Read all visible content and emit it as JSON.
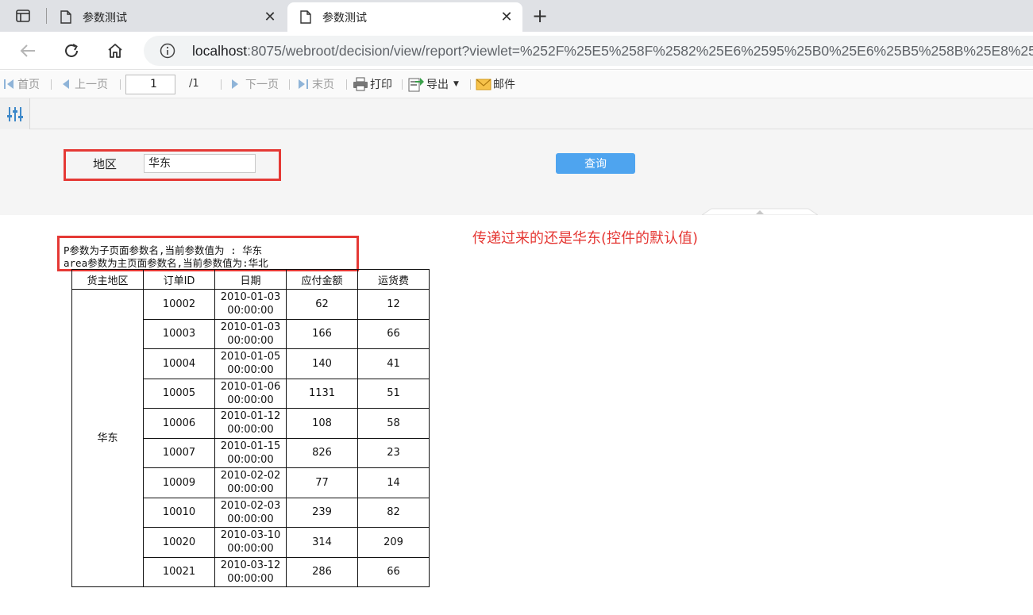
{
  "browser": {
    "tabs": [
      {
        "title": "参数测试",
        "active": false
      },
      {
        "title": "参数测试",
        "active": true
      }
    ],
    "close_glyph": "✕",
    "newtab_glyph": "+",
    "url_host": "localhost",
    "url_rest": ":8075/webroot/decision/view/report?viewlet=%252F%25E5%258F%2582%25E6%2595%25B0%25E6%25B5%258B%25E8%25AF%25"
  },
  "toolbar": {
    "first": "首页",
    "prev": "上一页",
    "page_value": "1",
    "page_total": "/1",
    "next": "下一页",
    "last": "末页",
    "print": "打印",
    "export": "导出",
    "mail": "邮件"
  },
  "params": {
    "area_label": "地区",
    "area_value": "华东",
    "query_label": "查询"
  },
  "annotation": "传递过来的还是华东(控件的默认值)",
  "param_info": {
    "line1": "P参数为子页面参数名,当前参数值为 : 华东",
    "line2": "area参数为主页面参数名,当前参数值为:华北"
  },
  "table": {
    "headers": [
      "货主地区",
      "订单ID",
      "日期",
      "应付金额",
      "运货费"
    ],
    "region": "华东",
    "time": "00:00:00",
    "rows": [
      {
        "id": "10002",
        "date": "2010-01-03",
        "amount": "62",
        "freight": "12"
      },
      {
        "id": "10003",
        "date": "2010-01-03",
        "amount": "166",
        "freight": "66"
      },
      {
        "id": "10004",
        "date": "2010-01-05",
        "amount": "140",
        "freight": "41"
      },
      {
        "id": "10005",
        "date": "2010-01-06",
        "amount": "1131",
        "freight": "51"
      },
      {
        "id": "10006",
        "date": "2010-01-12",
        "amount": "108",
        "freight": "58"
      },
      {
        "id": "10007",
        "date": "2010-01-15",
        "amount": "826",
        "freight": "23"
      },
      {
        "id": "10009",
        "date": "2010-02-02",
        "amount": "77",
        "freight": "14"
      },
      {
        "id": "10010",
        "date": "2010-02-03",
        "amount": "239",
        "freight": "82"
      },
      {
        "id": "10020",
        "date": "2010-03-10",
        "amount": "314",
        "freight": "209"
      },
      {
        "id": "10021",
        "date": "2010-03-12",
        "amount": "286",
        "freight": "66"
      }
    ]
  },
  "colors": {
    "highlight_red": "#e53935",
    "query_blue": "#4ea4ef"
  }
}
